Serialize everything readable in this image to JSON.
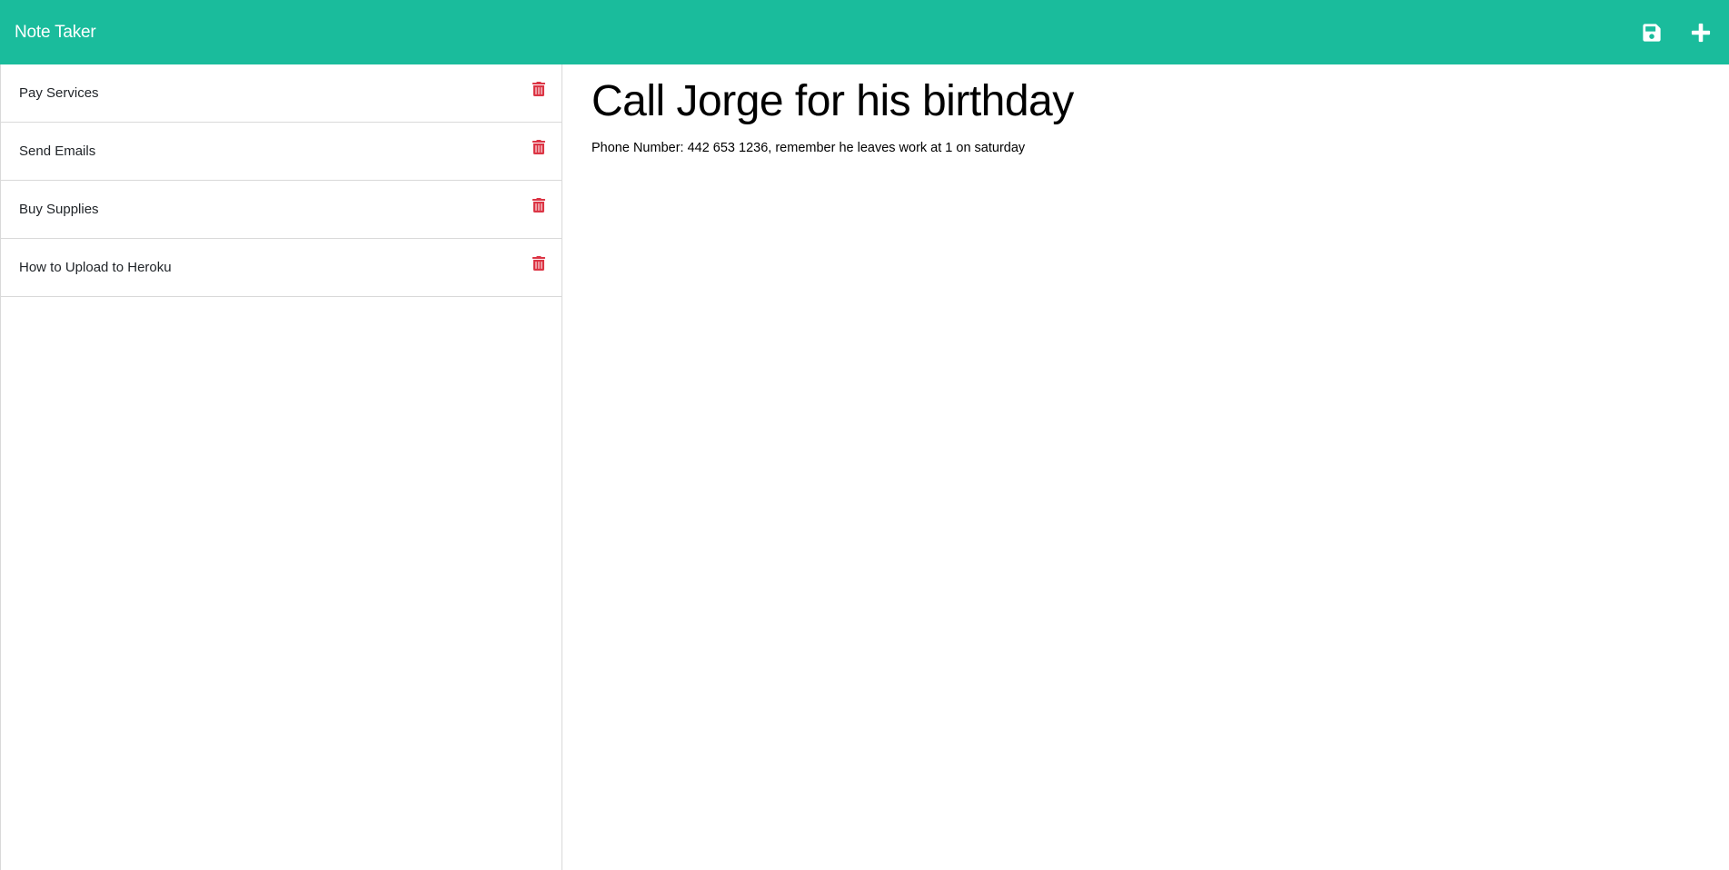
{
  "navbar": {
    "brand": "Note Taker",
    "save_icon": "floppy-disk-icon",
    "new_icon": "plus-icon",
    "background": "#1abc9c"
  },
  "notes": [
    {
      "title": "Pay Services",
      "delete_icon": "trash-icon"
    },
    {
      "title": "Send Emails",
      "delete_icon": "trash-icon"
    },
    {
      "title": "Buy Supplies",
      "delete_icon": "trash-icon"
    },
    {
      "title": "How to Upload to Heroku",
      "delete_icon": "trash-icon"
    }
  ],
  "active_note": {
    "title": "Call Jorge for his birthday",
    "text": "Phone Number: 442 653 1236, remember he leaves work at 1 on saturday"
  },
  "colors": {
    "accent": "#1abc9c",
    "delete": "#dc3545"
  }
}
